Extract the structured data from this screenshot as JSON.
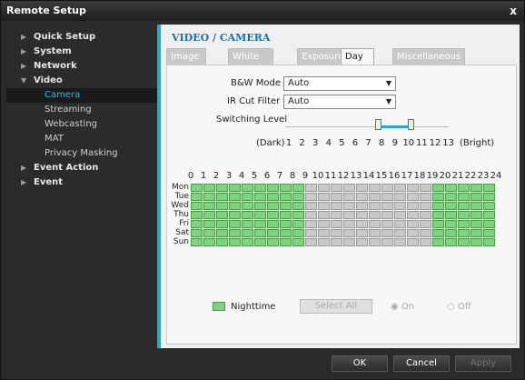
{
  "window": {
    "title": "Remote Setup",
    "close_glyph": "x"
  },
  "sidebar": {
    "items": [
      {
        "label": "Quick Setup",
        "arrow": "▶"
      },
      {
        "label": "System",
        "arrow": "▶"
      },
      {
        "label": "Network",
        "arrow": "▶"
      },
      {
        "label": "Video",
        "arrow": "▼"
      }
    ],
    "video_children": [
      "Camera",
      "Streaming",
      "Webcasting",
      "MAT",
      "Privacy Masking"
    ],
    "items_after": [
      {
        "label": "Event Action",
        "arrow": "▶"
      },
      {
        "label": "Event",
        "arrow": "▶"
      }
    ]
  },
  "main": {
    "title": "VIDEO / CAMERA",
    "tabs": [
      "Image Sensor",
      "White Balance",
      "Exposure",
      "Day & Night",
      "Miscellaneous"
    ],
    "active_tab": "Day & Night",
    "bw_mode": {
      "label": "B&W Mode",
      "value": "Auto"
    },
    "ir_cut_filter": {
      "label": "IR Cut Filter",
      "value": "Auto"
    },
    "switching_level": {
      "label": "Switching Level",
      "dark_label": "(Dark)",
      "bright_label": "(Bright)",
      "ticks": [
        "1",
        "2",
        "3",
        "4",
        "5",
        "6",
        "7",
        "8",
        "9",
        "10",
        "11",
        "12",
        "13"
      ],
      "range": [
        7,
        10
      ]
    },
    "schedule": {
      "hours": [
        "0",
        "1",
        "2",
        "3",
        "4",
        "5",
        "6",
        "7",
        "8",
        "9",
        "10",
        "11",
        "12",
        "13",
        "14",
        "15",
        "16",
        "17",
        "18",
        "19",
        "20",
        "21",
        "22",
        "23",
        "24"
      ],
      "days": [
        "Mon",
        "Tue",
        "Wed",
        "Thu",
        "Fri",
        "Sat",
        "Sun"
      ],
      "night_hours": [
        0,
        1,
        2,
        3,
        4,
        5,
        6,
        7,
        8,
        19,
        20,
        21,
        22,
        23
      ]
    },
    "legend": {
      "label": "Nighttime"
    },
    "select_all_label": "Select All",
    "radio_on": "On",
    "radio_off": "Off"
  },
  "footer": {
    "ok": "OK",
    "cancel": "Cancel",
    "apply": "Apply"
  },
  "colors": {
    "accent": "#2aa8c9",
    "night": "#7ed37e",
    "title_blue": "#1a6fae"
  }
}
